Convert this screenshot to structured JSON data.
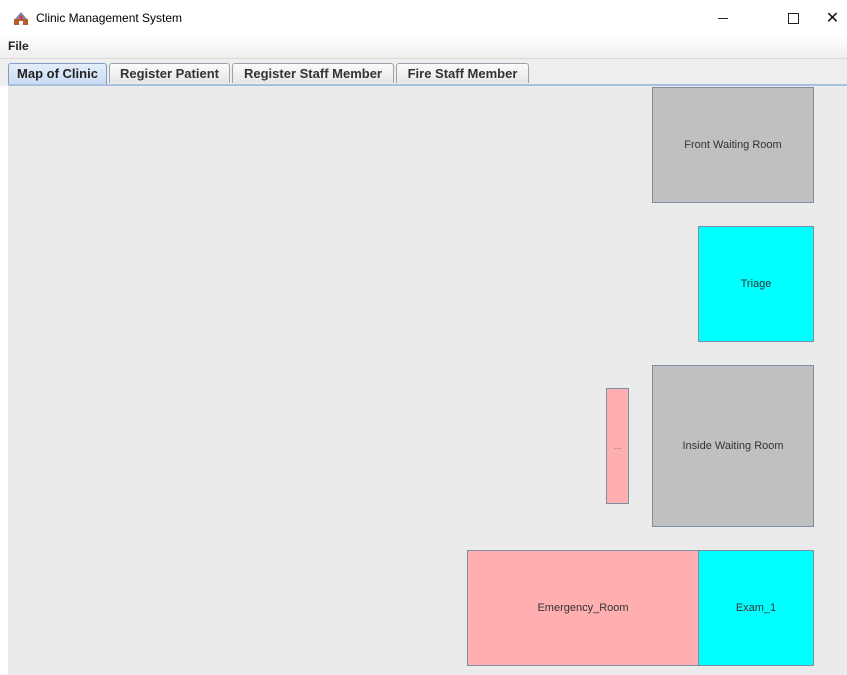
{
  "window": {
    "title": "Clinic Management System",
    "icons": {
      "app": "clinic-app-icon",
      "minimize": "minimize-icon",
      "maximize": "maximize-icon",
      "close": "close-icon"
    },
    "close_glyph": "✕"
  },
  "menubar": {
    "file_label": "File"
  },
  "tabs": [
    {
      "label": "Map of Clinic",
      "active": true
    },
    {
      "label": "Register Patient",
      "active": false
    },
    {
      "label": "Register Staff Member",
      "active": false
    },
    {
      "label": "Fire Staff Member",
      "active": false
    }
  ],
  "map": {
    "rooms": [
      {
        "label": "Front Waiting Room",
        "color": "#c0c0c0"
      },
      {
        "label": "Triage",
        "color": "#00ffff"
      },
      {
        "label": "...",
        "color": "#ffafaf"
      },
      {
        "label": "Inside Waiting Room",
        "color": "#c0c0c0"
      },
      {
        "label": "Emergency_Room",
        "color": "#ffafaf"
      },
      {
        "label": "Exam_1",
        "color": "#00ffff"
      }
    ]
  },
  "colors": {
    "background": "#ebebeb",
    "tab_active": "#c8daf3",
    "room_border": "#7f8ea3"
  }
}
